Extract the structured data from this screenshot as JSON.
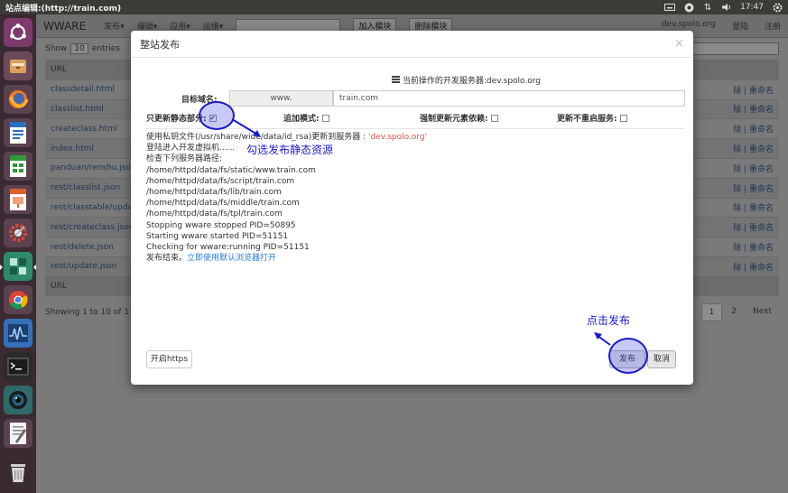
{
  "window_title": "站点编辑:(http://train.com)",
  "tray": {
    "time": "17:47"
  },
  "launcher_apps": [
    "ubuntu-logo-icon",
    "files-icon",
    "firefox-icon",
    "writer-icon",
    "calc-icon",
    "impress-icon",
    "settings-icon",
    "app-grid-icon",
    "chrome-icon",
    "system-monitor-icon",
    "terminal-icon",
    "camera-icon",
    "text-editor-icon",
    "trash-icon"
  ],
  "background": {
    "brand": "WWARE",
    "menu": [
      "发布▾",
      "编辑▾",
      "应用▾",
      "运维▾"
    ],
    "add_module": "加入模块",
    "delete_module": "删除模块",
    "server": "dev.spolo.org",
    "login": "登陆",
    "register": "注册",
    "show_prefix": "Show",
    "show_value": "10",
    "show_suffix": "entries",
    "col_url": "URL",
    "rows": [
      "classdetail.html",
      "classlist.html",
      "createclass.html",
      "index.html",
      "panduan/renshu.json",
      "rest/classlist.json",
      "rest/classtable/update.js",
      "rest/createclass.json",
      "rest/delete.json",
      "rest/update.json"
    ],
    "row_action": "除 | 重命名",
    "foot_col": "URL",
    "showing": "Showing 1 to 10 of 11 ent",
    "pages": [
      "1",
      "2",
      "Next"
    ]
  },
  "modal": {
    "title": "整站发布",
    "close": "×",
    "server_line": "当前操作的开发服务器:dev.spolo.org",
    "domain_label": "目标域名:",
    "domain_prefix": "www.",
    "domain_value": "train.com",
    "opt_static": "只更新静态部分:",
    "opt_static_checked": true,
    "opt_append": "追加模式:",
    "opt_force": "强制更新元素依赖:",
    "opt_norestart": "更新不重启服务:",
    "log": [
      "使用私钥文件(/usr/share/wide/data/id_rsa)更新到服务器 : ",
      "登陆进入开发虚拟机......",
      "检查下列服务器路径:",
      "/home/httpd/data/fs/static/www.train.com",
      "/home/httpd/data/fs/script/train.com",
      "/home/httpd/data/fs/lib/train.com",
      "/home/httpd/data/fs/middle/train.com",
      "/home/httpd/data/fs/tpl/train.com",
      "Stopping wware stopped PID=50895",
      "Starting wware started PID=51151",
      "Checking for wware:running PID=51151",
      "发布结束。"
    ],
    "log_server": "'dev.spolo.org'",
    "open_link": "立即使用默认浏览器打开",
    "btn_https": "开启https",
    "btn_publish": "发布",
    "btn_cancel": "取消"
  },
  "annotations": {
    "check_static": "勾选发布静态资源",
    "click_publish": "点击发布"
  }
}
